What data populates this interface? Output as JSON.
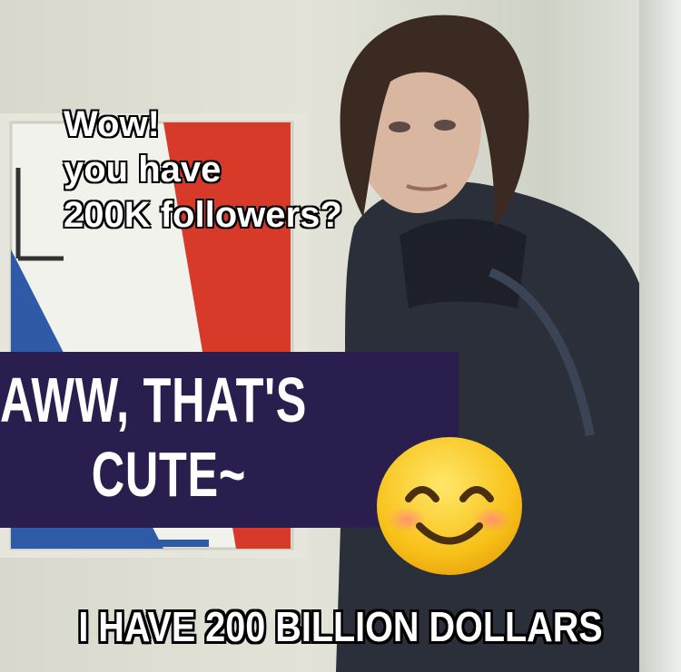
{
  "meme": {
    "top_caption": {
      "line1": "Wow!",
      "line2": "you have",
      "line3": "200K followers?"
    },
    "banner": {
      "line1": "AWW, THAT'S",
      "line2": "CUTE~",
      "background": "#2a1e4f"
    },
    "emoji": "smiling-face-with-smiling-eyes-icon",
    "bottom_caption": "I HAVE 200 BILLION DOLLARS"
  }
}
